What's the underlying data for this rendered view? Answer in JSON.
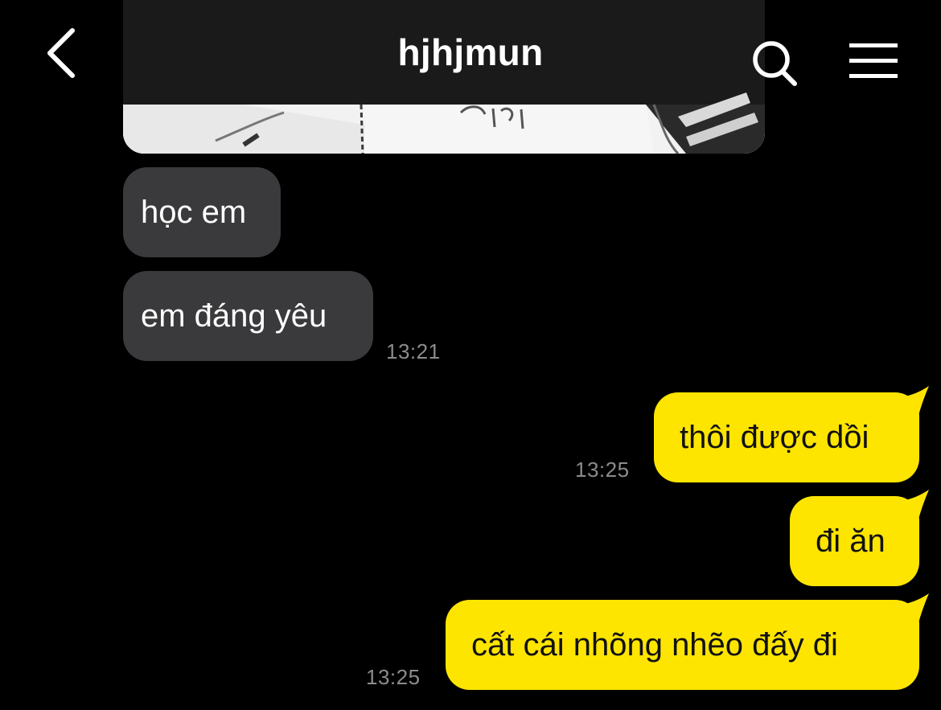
{
  "header": {
    "title": "hjhjmun",
    "back_icon": "chevron-left-icon",
    "search_icon": "search-icon",
    "menu_icon": "hamburger-menu-icon"
  },
  "attachment": {
    "type": "photo"
  },
  "messages": [
    {
      "direction": "incoming",
      "text": "học em",
      "time": ""
    },
    {
      "direction": "incoming",
      "text": "em đáng yêu",
      "time": "13:21"
    },
    {
      "direction": "outgoing",
      "text": "thôi được dồi",
      "time": "13:25"
    },
    {
      "direction": "outgoing",
      "text": "đi ăn",
      "time": ""
    },
    {
      "direction": "outgoing",
      "text": "cất cái nhõng nhẽo đấy đi",
      "time": "13:25"
    }
  ],
  "colors": {
    "background": "#000000",
    "incoming_bubble": "#3a3a3c",
    "outgoing_bubble": "#fee500",
    "timestamp": "#8c8c8c"
  }
}
